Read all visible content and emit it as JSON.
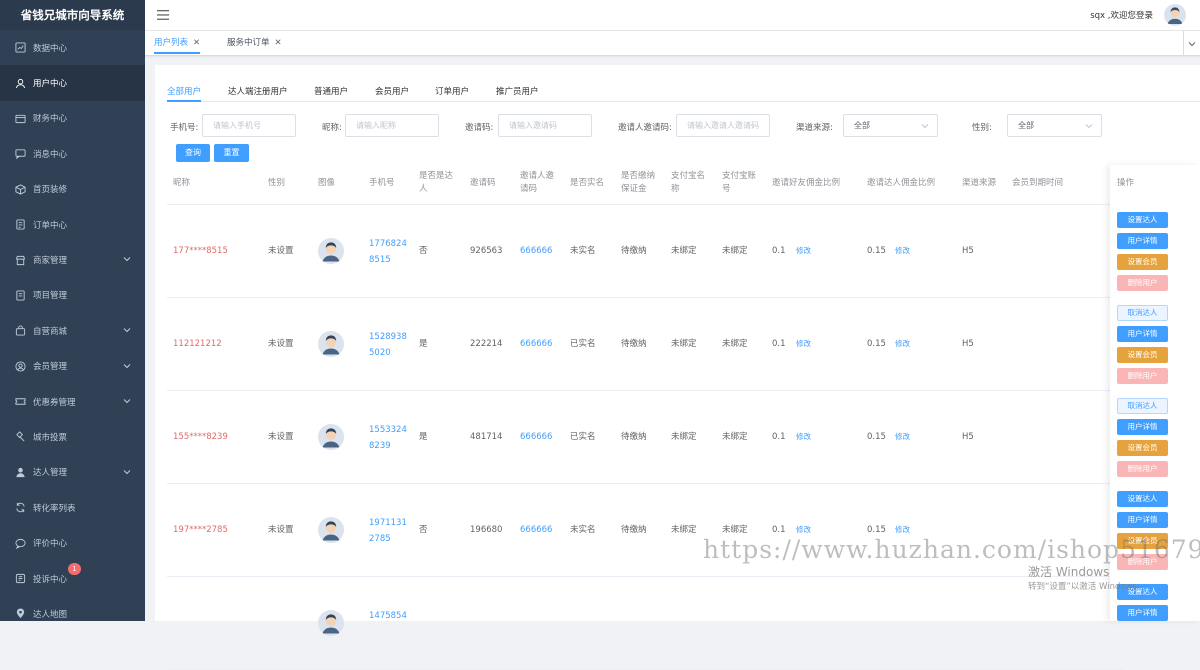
{
  "app": {
    "title": "省钱兄城市向导系统"
  },
  "sidebar": {
    "items": [
      {
        "label": "数据中心",
        "icon": "chart-icon",
        "active": false,
        "expandable": false
      },
      {
        "label": "用户中心",
        "icon": "user-icon",
        "active": true,
        "expandable": false
      },
      {
        "label": "财务中心",
        "icon": "wallet-icon",
        "active": false,
        "expandable": false
      },
      {
        "label": "消息中心",
        "icon": "message-icon",
        "active": false,
        "expandable": false
      },
      {
        "label": "首页装修",
        "icon": "box-icon",
        "active": false,
        "expandable": false
      },
      {
        "label": "订单中心",
        "icon": "order-icon",
        "active": false,
        "expandable": false
      },
      {
        "label": "商家管理",
        "icon": "shop-icon",
        "active": false,
        "expandable": true
      },
      {
        "label": "项目管理",
        "icon": "document-icon",
        "active": false,
        "expandable": false
      },
      {
        "label": "自营商城",
        "icon": "bag-icon",
        "active": false,
        "expandable": true
      },
      {
        "label": "会员管理",
        "icon": "member-icon",
        "active": false,
        "expandable": true
      },
      {
        "label": "优惠券管理",
        "icon": "coupon-icon",
        "active": false,
        "expandable": true
      },
      {
        "label": "城市投票",
        "icon": "hammer-icon",
        "active": false,
        "expandable": false
      },
      {
        "label": "达人管理",
        "icon": "people-icon",
        "active": false,
        "expandable": true
      },
      {
        "label": "转化率列表",
        "icon": "refresh-icon",
        "active": false,
        "expandable": false
      },
      {
        "label": "评价中心",
        "icon": "comment-icon",
        "active": false,
        "expandable": false
      },
      {
        "label": "投诉中心",
        "icon": "complaint-icon",
        "active": false,
        "expandable": false,
        "badge": "1"
      },
      {
        "label": "达人地图",
        "icon": "location-icon",
        "active": false,
        "expandable": false
      }
    ]
  },
  "header": {
    "welcome": "sqx ,欢迎您登录"
  },
  "view_tabs": [
    {
      "label": "用户列表",
      "active": true
    },
    {
      "label": "服务中订单",
      "active": false
    }
  ],
  "sub_tabs": [
    "全部用户",
    "达人端注册用户",
    "普通用户",
    "会员用户",
    "订单用户",
    "推广员用户"
  ],
  "filters": {
    "phone": {
      "label": "手机号:",
      "placeholder": "请输入手机号"
    },
    "nickname": {
      "label": "昵称:",
      "placeholder": "请输入昵称"
    },
    "invite_code": {
      "label": "邀请码:",
      "placeholder": "请输入邀请码"
    },
    "inviter_code": {
      "label": "邀请人邀请码:",
      "placeholder": "请输入邀请人邀请码"
    },
    "channel": {
      "label": "渠道来源:",
      "value": "全部"
    },
    "gender": {
      "label": "性别:",
      "value": "全部"
    },
    "search_button": "查询",
    "reset_button": "重置"
  },
  "table": {
    "headers": {
      "nickname": "昵称",
      "gender": "性别",
      "avatar": "图像",
      "phone": "手机号",
      "is_talent": "是否是达人",
      "invite_code": "邀请码",
      "inviter_code": "邀请人邀请码",
      "realname": "是否实名",
      "deposit": "是否缴纳保证金",
      "alipay_name": "支付宝名称",
      "alipay_account": "支付宝账号",
      "friend_ratio": "邀请好友佣金比例",
      "talent_ratio": "邀请达人佣金比例",
      "channel": "渠道来源",
      "member_expire": "会员到期时间",
      "actions": "操作"
    },
    "rows": [
      {
        "nickname": "177****8515",
        "gender": "未设置",
        "phone1": "1776824",
        "phone2": "8515",
        "is_talent": "否",
        "invite_code": "926563",
        "inviter_code": "666666",
        "realname": "未实名",
        "deposit": "待缴纳",
        "alipay_name": "未绑定",
        "alipay_account": "未绑定",
        "friend_ratio": "0.1",
        "talent_ratio": "0.15",
        "edit": "修改",
        "channel": "H5",
        "member_expire": "",
        "actions": [
          "设置达人",
          "用户详情",
          "设置会员",
          "删除用户"
        ],
        "talent_set": false
      },
      {
        "nickname": "112121212",
        "gender": "未设置",
        "phone1": "1528938",
        "phone2": "5020",
        "is_talent": "是",
        "invite_code": "222214",
        "inviter_code": "666666",
        "realname": "已实名",
        "deposit": "待缴纳",
        "alipay_name": "未绑定",
        "alipay_account": "未绑定",
        "friend_ratio": "0.1",
        "talent_ratio": "0.15",
        "edit": "修改",
        "channel": "H5",
        "member_expire": "",
        "actions": [
          "取消达人",
          "用户详情",
          "设置会员",
          "删除用户"
        ],
        "talent_set": true
      },
      {
        "nickname": "155****8239",
        "gender": "未设置",
        "phone1": "1553324",
        "phone2": "8239",
        "is_talent": "是",
        "invite_code": "481714",
        "inviter_code": "666666",
        "realname": "已实名",
        "deposit": "待缴纳",
        "alipay_name": "未绑定",
        "alipay_account": "未绑定",
        "friend_ratio": "0.1",
        "talent_ratio": "0.15",
        "edit": "修改",
        "channel": "H5",
        "member_expire": "",
        "actions": [
          "取消达人",
          "用户详情",
          "设置会员",
          "删除用户"
        ],
        "talent_set": true
      },
      {
        "nickname": "197****2785",
        "gender": "未设置",
        "phone1": "1971131",
        "phone2": "2785",
        "is_talent": "否",
        "invite_code": "196680",
        "inviter_code": "666666",
        "realname": "未实名",
        "deposit": "待缴纳",
        "alipay_name": "未绑定",
        "alipay_account": "未绑定",
        "friend_ratio": "0.1",
        "talent_ratio": "0.15",
        "edit": "修改",
        "channel": "",
        "member_expire": "",
        "actions": [
          "设置达人",
          "用户详情",
          "设置会员",
          "删除用户"
        ],
        "talent_set": false
      },
      {
        "nickname": "",
        "gender": "",
        "phone1": "1475854",
        "phone2": "",
        "is_talent": "",
        "invite_code": "",
        "inviter_code": "",
        "realname": "",
        "deposit": "",
        "alipay_name": "",
        "alipay_account": "",
        "friend_ratio": "",
        "talent_ratio": "",
        "edit": "",
        "channel": "",
        "member_expire": "",
        "actions": [
          "设置达人",
          "用户详情"
        ],
        "talent_set": false
      }
    ]
  },
  "overlay": {
    "watermark": "https://www.huzhan.com/ishop51679",
    "win_activate_1": "激活 Windows",
    "win_activate_2": "转到“设置”以激活 Windows。"
  },
  "colors": {
    "sidebar_bg": "#304156",
    "primary": "#409eff",
    "warning": "#e6a23c",
    "danger_light": "#fab6b6",
    "nickname_red": "#e06b6b"
  }
}
